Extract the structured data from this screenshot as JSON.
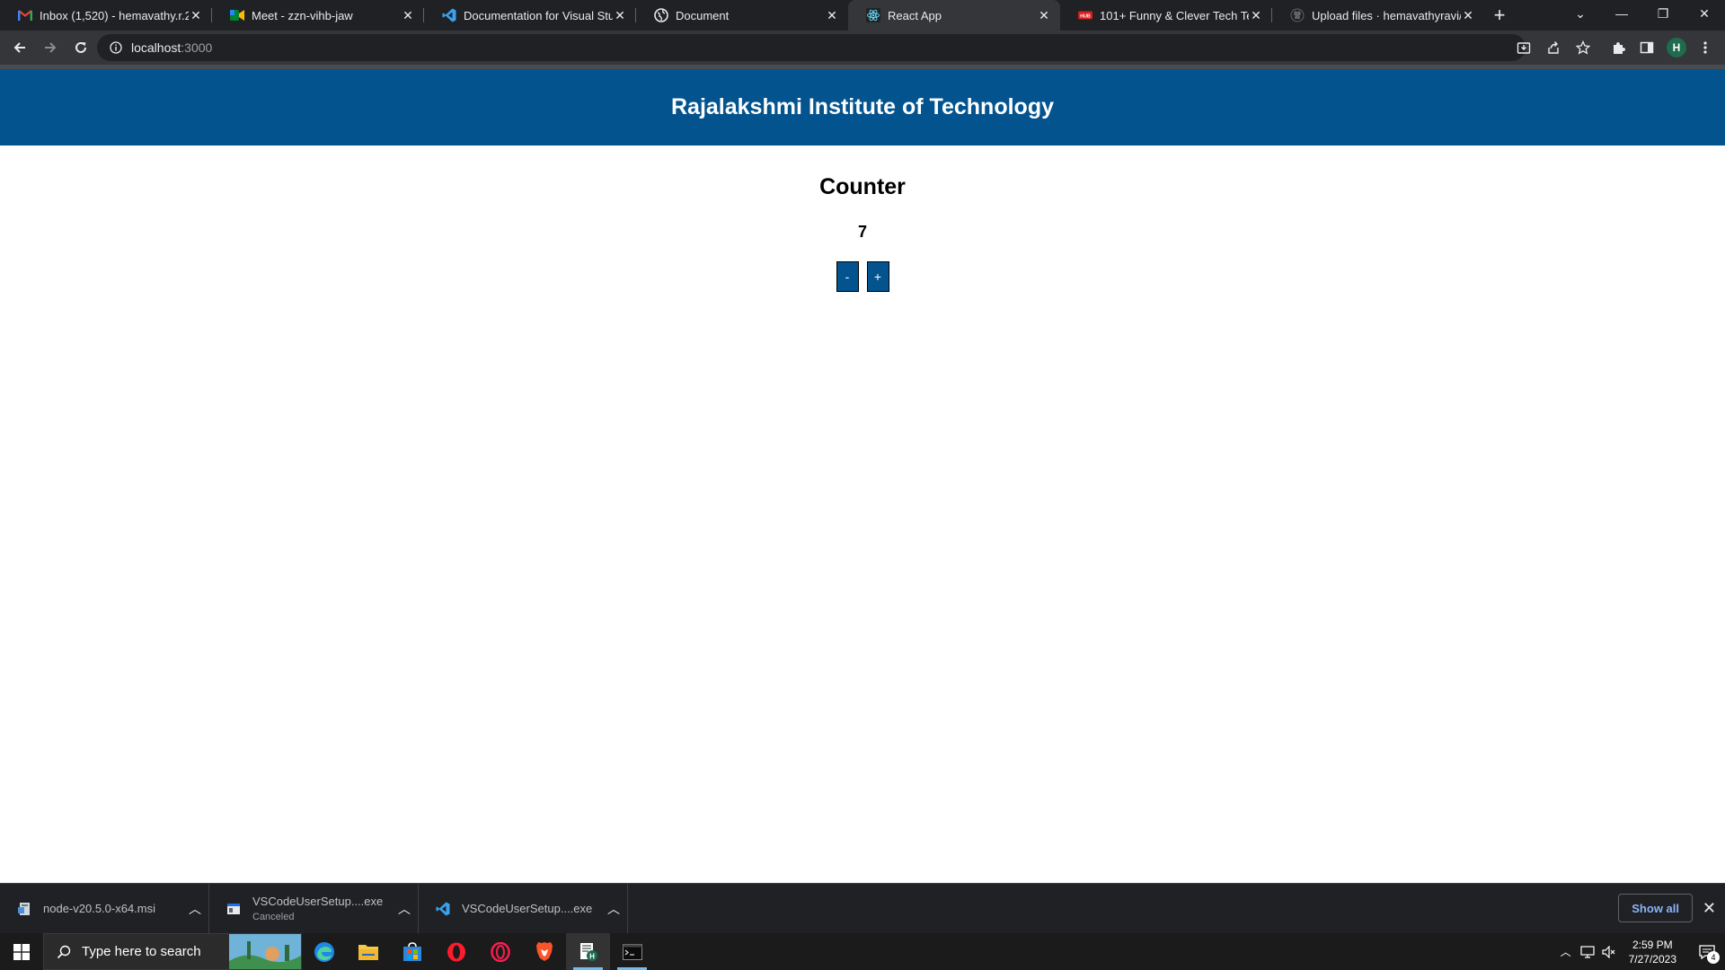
{
  "browser": {
    "tabs": [
      {
        "title": "Inbox (1,520) - hemavathy.r.2021",
        "favicon": "gmail-icon",
        "active": false
      },
      {
        "title": "Meet - zzn-vihb-jaw",
        "favicon": "google-meet-icon",
        "active": false
      },
      {
        "title": "Documentation for Visual Studio Code",
        "favicon": "vscode-icon",
        "active": false
      },
      {
        "title": "Document",
        "favicon": "globe-icon",
        "active": false
      },
      {
        "title": "React App",
        "favicon": "react-icon",
        "active": true
      },
      {
        "title": "101+ Funny & Clever Tech Team Names",
        "favicon": "hubspot-icon",
        "active": false
      },
      {
        "title": "Upload files · hemavathyravi/my",
        "favicon": "github-icon",
        "active": false
      }
    ],
    "address": "localhost:3000",
    "address_host": "localhost",
    "address_port": ":3000",
    "profile_initial": "H"
  },
  "page": {
    "header_title": "Rajalakshmi Institute of Technology",
    "counter_title": "Counter",
    "counter_value": "7",
    "decrement_label": "-",
    "increment_label": "+"
  },
  "downloads": {
    "items": [
      {
        "name": "node-v20.5.0-x64.msi",
        "status": "",
        "icon": "msi-installer-icon"
      },
      {
        "name": "VSCodeUserSetup....exe",
        "status": "Canceled",
        "icon": "exe-file-icon"
      },
      {
        "name": "VSCodeUserSetup....exe",
        "status": "",
        "icon": "vscode-icon"
      }
    ],
    "show_all_label": "Show all"
  },
  "taskbar": {
    "search_placeholder": "Type here to search",
    "time": "2:59 PM",
    "date": "7/27/2023",
    "notification_count": "4"
  },
  "colors": {
    "accent": "#03538f",
    "chrome_dark": "#202124",
    "chrome_toolbar": "#35363a"
  }
}
